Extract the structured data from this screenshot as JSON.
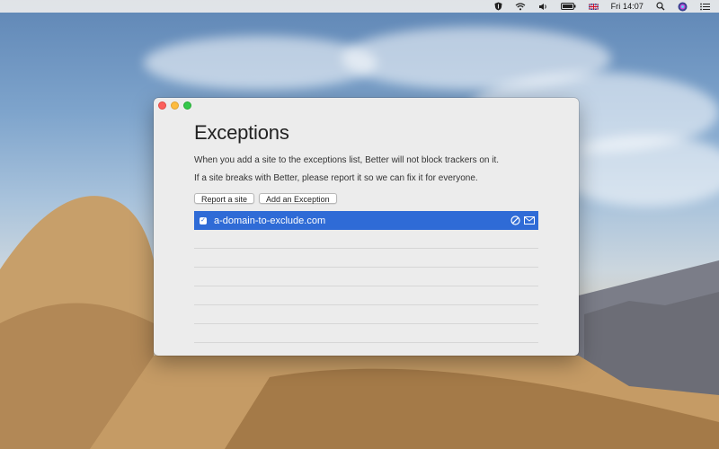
{
  "menubar": {
    "clock": "Fri 14:07",
    "icons": [
      "shield-icon",
      "wifi-icon",
      "volume-icon",
      "battery-icon",
      "uk-flag-icon",
      "search-icon",
      "siri-icon",
      "list-icon"
    ]
  },
  "window": {
    "title": "Exceptions",
    "description_1": "When you add a site to the exceptions list, Better will not block trackers on it.",
    "description_2": "If a site breaks with Better, please report it so we can fix it for everyone.",
    "report_button": "Report a site",
    "add_button": "Add an Exception",
    "exceptions": [
      {
        "domain": "a-domain-to-exclude.com",
        "checked": true
      }
    ],
    "row_icons": [
      "block-icon",
      "mail-icon"
    ]
  },
  "colors": {
    "selection": "#2f6bd6",
    "close": "#fc605c",
    "minimize": "#fdbc40",
    "maximize": "#34c84a"
  }
}
